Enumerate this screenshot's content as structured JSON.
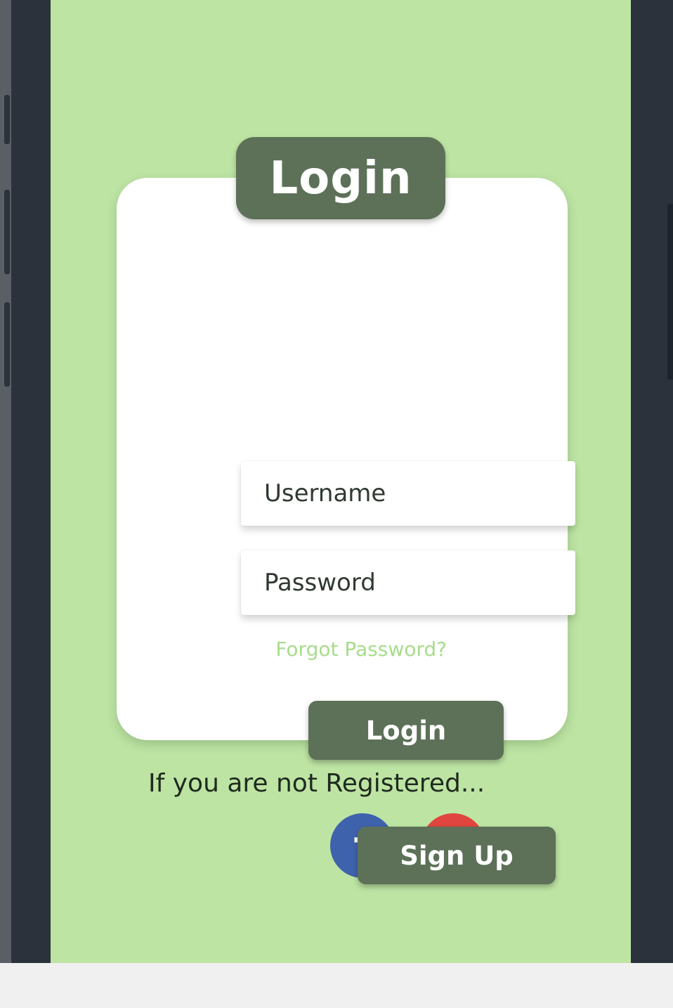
{
  "login_card": {
    "title": "Login",
    "username_placeholder": "Username",
    "password_placeholder": "Password",
    "forgot_password": "Forgot Password?",
    "login_button": "Login",
    "social": {
      "facebook_glyph": "f",
      "google_glyph": "G"
    }
  },
  "register": {
    "prompt": "If you are not Registered...",
    "signup_button": "Sign Up"
  },
  "colors": {
    "screen_background": "#bde4a3",
    "accent": "#5c7158",
    "forgot_link": "#a8dc8c",
    "facebook": "#3f62ad",
    "google": "#e0453f"
  },
  "icons": {
    "facebook": "facebook-icon",
    "google": "google-icon"
  }
}
